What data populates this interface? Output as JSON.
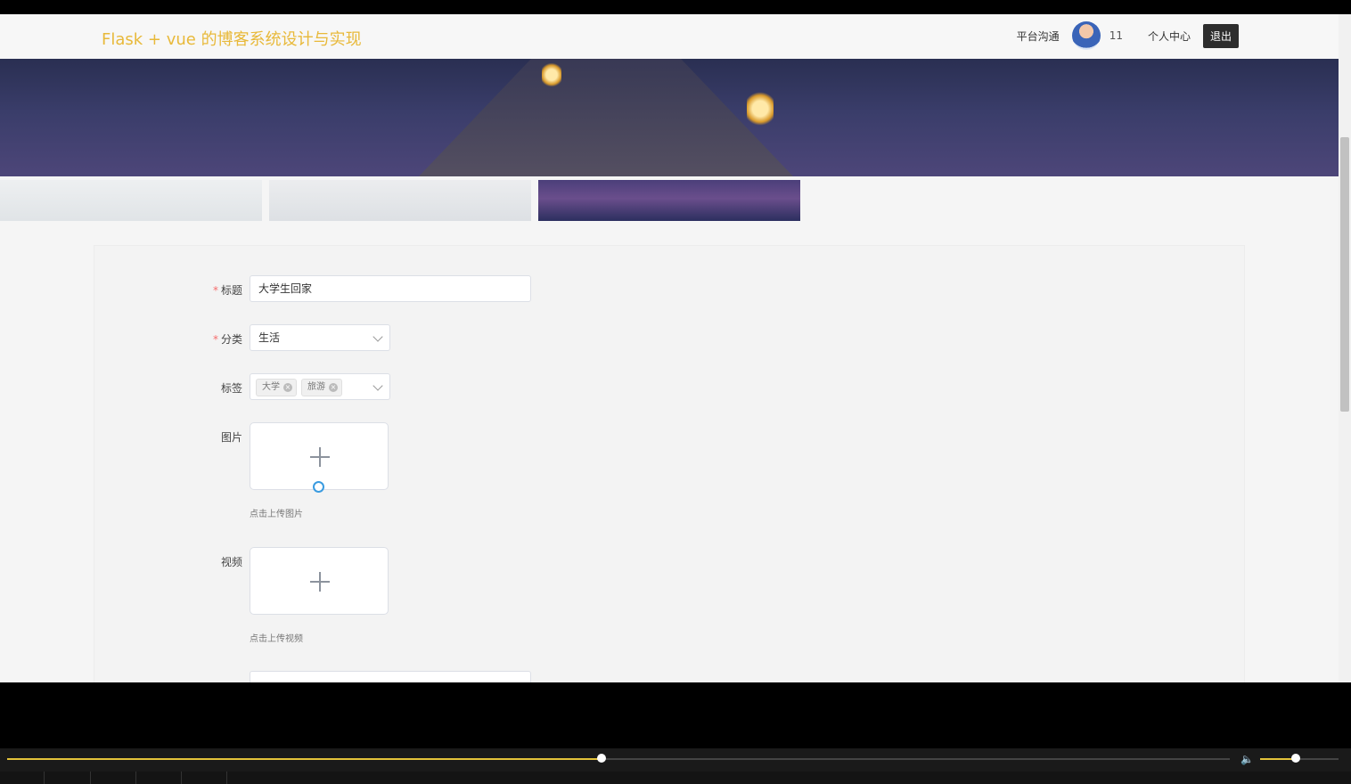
{
  "header": {
    "title": "Flask + vue 的博客系统设计与实现",
    "nav": {
      "chat": "平台沟通",
      "username": "11",
      "profile": "个人中心",
      "logout": "退出"
    }
  },
  "form": {
    "title": {
      "label": "标题",
      "value": "大学生回家"
    },
    "category": {
      "label": "分类",
      "value": "生活"
    },
    "tags": {
      "label": "标签",
      "items": [
        "大学",
        "旅游"
      ]
    },
    "image": {
      "label": "图片",
      "hint": "点击上传图片"
    },
    "video": {
      "label": "视频",
      "hint": "点击上传视频"
    }
  },
  "player": {
    "progress": 0.486,
    "volume": 0.45
  }
}
